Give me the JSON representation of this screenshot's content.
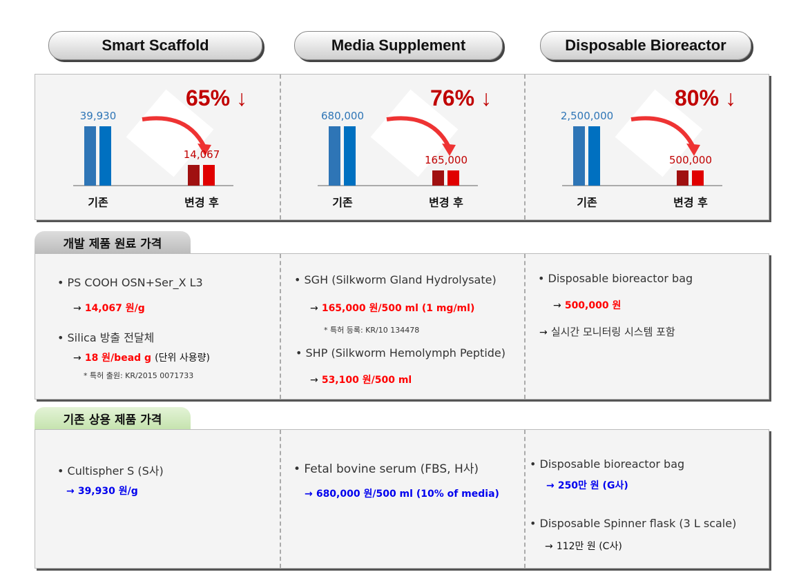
{
  "headers": [
    "Smart Scaffold",
    "Media Supplement",
    "Disposable Bioreactor"
  ],
  "chart_data": [
    {
      "type": "bar",
      "categories": [
        "기존",
        "변경 후"
      ],
      "values": [
        39930,
        14067
      ],
      "value_labels": [
        "39,930",
        "14,067"
      ],
      "reduction": "65% ↓"
    },
    {
      "type": "bar",
      "categories": [
        "기존",
        "변경 후"
      ],
      "values": [
        680000,
        165000
      ],
      "value_labels": [
        "680,000",
        "165,000"
      ],
      "reduction": "76% ↓"
    },
    {
      "type": "bar",
      "categories": [
        "기존",
        "변경 후"
      ],
      "values": [
        2500000,
        500000
      ],
      "value_labels": [
        "2,500,000",
        "500,000"
      ],
      "reduction": "80% ↓"
    }
  ],
  "colors": {
    "before": "#2e75b6",
    "after": "#c00000",
    "reduction": "#c00000",
    "dev_price": "#ff0000",
    "com_price": "#0000ee"
  },
  "dev_section": {
    "title": "개발 제품 원료 가격",
    "col1": {
      "item1": "• PS COOH OSN+Ser_X L3",
      "price1": "14,067 원/g",
      "item2": "• Silica 방출 전달체",
      "price2": "18 원/bead g",
      "note2": "(단위 사용량)",
      "patent": "* 특허 출원: KR/2015 0071733"
    },
    "col2": {
      "item1": "• SGH (Silkworm Gland Hydrolysate)",
      "price1": "165,000 원/500 ml (1 mg/ml)",
      "patent": "* 특허 등록: KR/10 134478",
      "item2": "• SHP (Silkworm Hemolymph Peptide)",
      "price2": "53,100 원/500 ml"
    },
    "col3": {
      "item1": "• Disposable bioreactor bag",
      "price1": "500,000 원",
      "note": "실시간 모니터링 시스템 포함"
    }
  },
  "com_section": {
    "title": "기존 상용 제품 가격",
    "col1": {
      "item1": "• Cultispher S (S사)",
      "price1": "39,930 원/g"
    },
    "col2": {
      "item1": "• Fetal bovine serum (FBS, H사)",
      "price1": "680,000 원/500 ml (10% of media)"
    },
    "col3": {
      "item1": "• Disposable bioreactor bag",
      "price1": "250만 원 (G사)",
      "item2": "• Disposable Spinner flask (3 L scale)",
      "price2": "112만 원 (C사)"
    }
  },
  "arrow": "→"
}
